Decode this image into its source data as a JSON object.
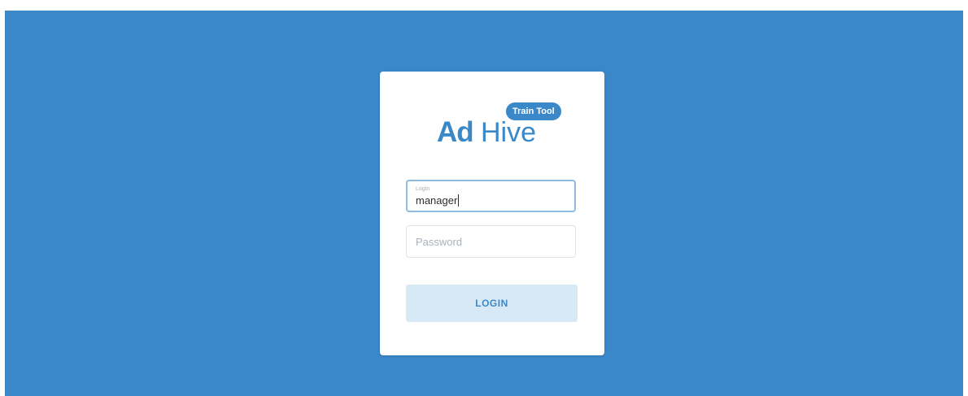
{
  "brand": {
    "logo_ad": "Ad",
    "logo_hive": "Hive",
    "badge": "Train Tool"
  },
  "form": {
    "login": {
      "label": "Login",
      "value": "manager"
    },
    "password": {
      "placeholder": "Password",
      "value": ""
    },
    "submit_label": "LOGIN"
  },
  "colors": {
    "background": "#3b88c8",
    "accent": "#3b88c8",
    "button_bg": "#d8e9f6"
  }
}
